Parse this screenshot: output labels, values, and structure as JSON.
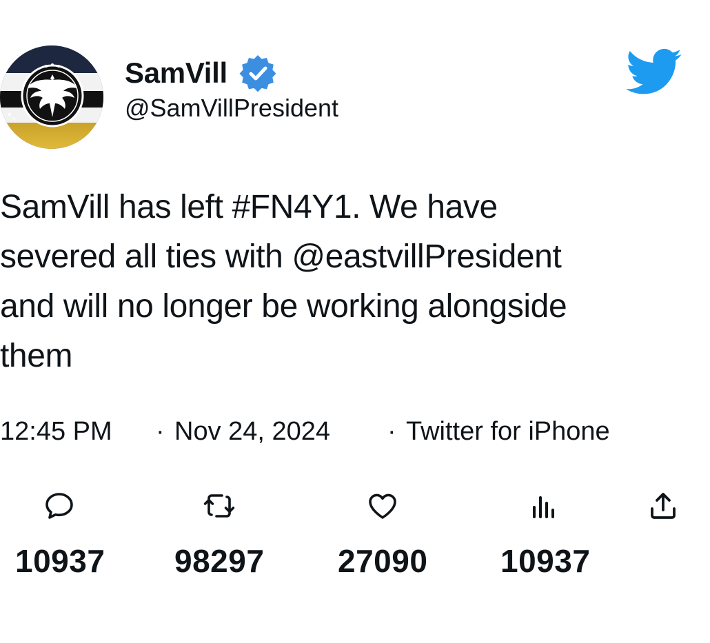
{
  "header": {
    "display_name": "SamVill",
    "handle": "@SamVillPresident",
    "verified_icon": "verified-badge-icon",
    "logo_icon": "twitter-bird-icon",
    "avatar_icon": "eagle-emblem-icon",
    "colors": {
      "verified": "#3b8ee0",
      "twitter_blue": "#1d9bf0"
    }
  },
  "tweet": {
    "text": "SamVill has left #FN4Y1. We have\nsevered all ties with @eastvillPresident\nand will no longer be working alongside\nthem"
  },
  "meta": {
    "time": "12:45 PM",
    "separator": "·",
    "date": "Nov 24, 2024",
    "source": "Twitter for iPhone"
  },
  "actions": [
    {
      "icon": "reply-icon",
      "count": "10937"
    },
    {
      "icon": "retweet-icon",
      "count": "98297"
    },
    {
      "icon": "like-icon",
      "count": "27090"
    },
    {
      "icon": "views-icon",
      "count": "10937"
    },
    {
      "icon": "share-icon"
    }
  ]
}
